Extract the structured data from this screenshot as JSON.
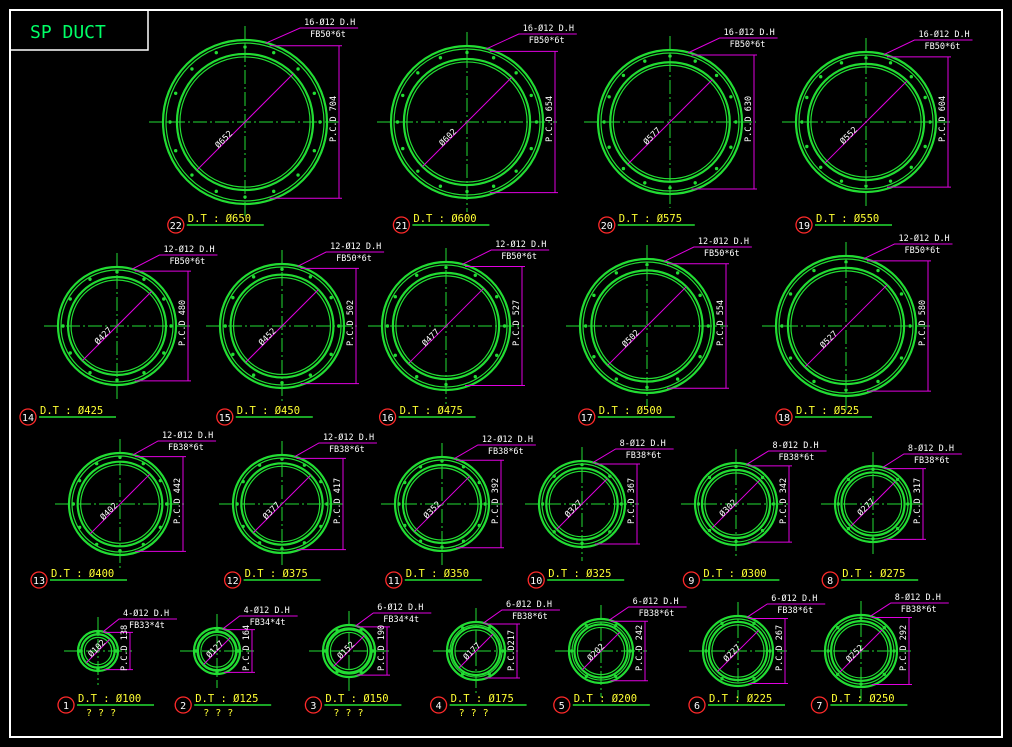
{
  "title": "SP DUCT",
  "colors": {
    "ring": "#22dd33",
    "dimension": "#e000e0",
    "label": "#ffff33",
    "index_circle": "#ff2a2a",
    "text": "#ffffff"
  },
  "flanges": [
    {
      "n": "22",
      "dt": "D.T : Ø650",
      "holes": "16-Ø12 D.H",
      "fb": "FB50*6t",
      "dia": "Ø652",
      "pcd": "P.C.D 704",
      "hole_count": 16
    },
    {
      "n": "21",
      "dt": "D.T : Ø600",
      "holes": "16-Ø12 D.H",
      "fb": "FB50*6t",
      "dia": "Ø602",
      "pcd": "P.C.D 654",
      "hole_count": 16
    },
    {
      "n": "20",
      "dt": "D.T : Ø575",
      "holes": "16-Ø12 D.H",
      "fb": "FB50*6t",
      "dia": "Ø577",
      "pcd": "P.C.D 630",
      "hole_count": 16
    },
    {
      "n": "19",
      "dt": "D.T : Ø550",
      "holes": "16-Ø12 D.H",
      "fb": "FB50*6t",
      "dia": "Ø552",
      "pcd": "P.C.D 604",
      "hole_count": 16
    },
    {
      "n": "14",
      "dt": "D.T : Ø425",
      "holes": "12-Ø12 D.H",
      "fb": "FB50*6t",
      "dia": "Ø427",
      "pcd": "P.C.D 480",
      "hole_count": 12
    },
    {
      "n": "15",
      "dt": "D.T : Ø450",
      "holes": "12-Ø12 D.H",
      "fb": "FB50*6t",
      "dia": "Ø452",
      "pcd": "P.C.D 502",
      "hole_count": 12
    },
    {
      "n": "16",
      "dt": "D.T : Ø475",
      "holes": "12-Ø12 D.H",
      "fb": "FB50*6t",
      "dia": "Ø477",
      "pcd": "P.C.D 527",
      "hole_count": 12
    },
    {
      "n": "17",
      "dt": "D.T : Ø500",
      "holes": "12-Ø12 D.H",
      "fb": "FB50*6t",
      "dia": "Ø502",
      "pcd": "P.C.D 554",
      "hole_count": 12
    },
    {
      "n": "18",
      "dt": "D.T : Ø525",
      "holes": "12-Ø12 D.H",
      "fb": "FB50*6t",
      "dia": "Ø527",
      "pcd": "P.C.D 580",
      "hole_count": 12
    },
    {
      "n": "13",
      "dt": "D.T : Ø400",
      "holes": "12-Ø12 D.H",
      "fb": "FB38*6t",
      "dia": "Ø402",
      "pcd": "P.C.D 442",
      "hole_count": 12
    },
    {
      "n": "12",
      "dt": "D.T : Ø375",
      "holes": "12-Ø12 D.H",
      "fb": "FB38*6t",
      "dia": "Ø377",
      "pcd": "P.C.D 417",
      "hole_count": 12
    },
    {
      "n": "11",
      "dt": "D.T : Ø350",
      "holes": "12-Ø12 D.H",
      "fb": "FB38*6t",
      "dia": "Ø352",
      "pcd": "P.C.D 392",
      "hole_count": 12
    },
    {
      "n": "10",
      "dt": "D.T : Ø325",
      "holes": "8-Ø12 D.H",
      "fb": "FB38*6t",
      "dia": "Ø327",
      "pcd": "P.C.D 367",
      "hole_count": 8
    },
    {
      "n": "9",
      "dt": "D.T : Ø300",
      "holes": "8-Ø12 D.H",
      "fb": "FB38*6t",
      "dia": "Ø302",
      "pcd": "P.C.D 342",
      "hole_count": 8
    },
    {
      "n": "8",
      "dt": "D.T : Ø275",
      "holes": "8-Ø12 D.H",
      "fb": "FB38*6t",
      "dia": "Ø277",
      "pcd": "P.C.D 317",
      "hole_count": 8
    },
    {
      "n": "1",
      "dt": "D.T : Ø100",
      "holes": "4-Ø12 D.H",
      "fb": "FB33*4t",
      "dia": "Ø102",
      "pcd": "P.C.D 138",
      "hole_count": 4,
      "q": "? ? ?"
    },
    {
      "n": "2",
      "dt": "D.T : Ø125",
      "holes": "4-Ø12 D.H",
      "fb": "FB34*4t",
      "dia": "Ø127",
      "pcd": "P.C.D 164",
      "hole_count": 4,
      "q": "? ? ?"
    },
    {
      "n": "3",
      "dt": "D.T : Ø150",
      "holes": "6-Ø12 D.H",
      "fb": "FB34*4t",
      "dia": "Ø152",
      "pcd": "P.C.D 190",
      "hole_count": 6,
      "q": "? ? ?"
    },
    {
      "n": "4",
      "dt": "D.T : Ø175",
      "holes": "6-Ø12 D.H",
      "fb": "FB38*6t",
      "dia": "Ø177",
      "pcd": "P.C.D217",
      "hole_count": 6,
      "q": "? ? ?"
    },
    {
      "n": "5",
      "dt": "D.T : Ø200",
      "holes": "6-Ø12 D.H",
      "fb": "FB38*6t",
      "dia": "Ø202",
      "pcd": "P.C.D 242",
      "hole_count": 6
    },
    {
      "n": "6",
      "dt": "D.T : Ø225",
      "holes": "6-Ø12 D.H",
      "fb": "FB38*6t",
      "dia": "Ø227",
      "pcd": "P.C.D 267",
      "hole_count": 6
    },
    {
      "n": "7",
      "dt": "D.T : Ø250",
      "holes": "8-Ø12 D.H",
      "fb": "FB38*6t",
      "dia": "Ø252",
      "pcd": "P.C.D 292",
      "hole_count": 8
    }
  ]
}
